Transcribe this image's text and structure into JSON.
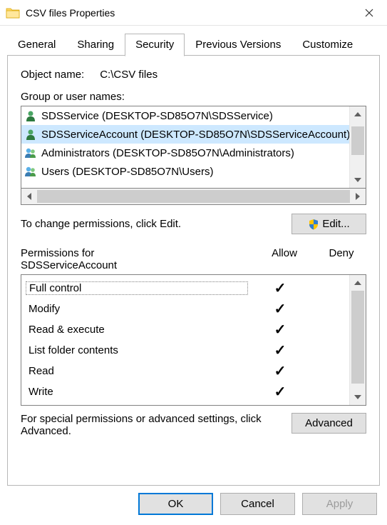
{
  "window": {
    "title": "CSV files Properties"
  },
  "tabs": [
    "General",
    "Sharing",
    "Security",
    "Previous Versions",
    "Customize"
  ],
  "active_tab": "Security",
  "object_label": "Object name:",
  "object_value": "C:\\CSV files",
  "group_label_pre": "G",
  "group_label_post": "roup or user names:",
  "users": [
    {
      "name": "SDSService (DESKTOP-SD85O7N\\SDSService)",
      "type": "single"
    },
    {
      "name": "SDSServiceAccount (DESKTOP-SD85O7N\\SDSServiceAccount)",
      "type": "single",
      "selected": true
    },
    {
      "name": "Administrators (DESKTOP-SD85O7N\\Administrators)",
      "type": "group"
    },
    {
      "name": "Users (DESKTOP-SD85O7N\\Users)",
      "type": "group"
    }
  ],
  "edit_hint": "To change permissions, click Edit.",
  "edit_btn_pre": "E",
  "edit_btn_post": "dit...",
  "perm_label_pre": "P",
  "perm_label_post": "ermissions for",
  "perm_target": "SDSServiceAccount",
  "col_allow": "Allow",
  "col_deny": "Deny",
  "permissions": [
    {
      "name": "Full control",
      "allow": true,
      "deny": false
    },
    {
      "name": "Modify",
      "allow": true,
      "deny": false
    },
    {
      "name": "Read & execute",
      "allow": true,
      "deny": false
    },
    {
      "name": "List folder contents",
      "allow": true,
      "deny": false
    },
    {
      "name": "Read",
      "allow": true,
      "deny": false
    },
    {
      "name": "Write",
      "allow": true,
      "deny": false
    }
  ],
  "adv_text": "For special permissions or advanced settings, click Advanced.",
  "adv_btn_pre": "Ad",
  "adv_btn_u": "v",
  "adv_btn_post": "anced",
  "buttons": {
    "ok": "OK",
    "cancel": "Cancel",
    "apply": "Apply"
  }
}
